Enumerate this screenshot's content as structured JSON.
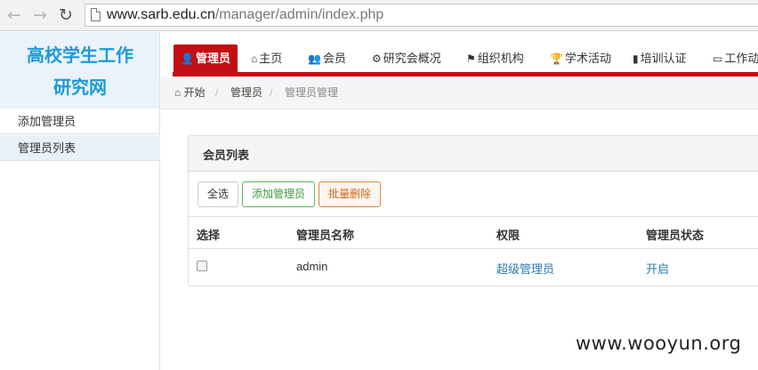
{
  "browser": {
    "back_icon": "←",
    "forward_icon": "→",
    "reload_icon": "↻",
    "url_host": "www.sarb.edu.cn",
    "url_path": "/manager/admin/index.php"
  },
  "logo": {
    "line1": "高校学生工作",
    "line2": "研究网",
    "color": "#1e9ad6"
  },
  "nav": {
    "accent": "#c50d14",
    "tabs": [
      {
        "icon": "user-icon",
        "glyph": "👤",
        "label": "管理员",
        "active": true
      },
      {
        "icon": "home-icon",
        "glyph": "⌂",
        "label": "主页"
      },
      {
        "icon": "users-icon",
        "glyph": "👥",
        "label": "会员"
      },
      {
        "icon": "gear-icon",
        "glyph": "⚙",
        "label": "研究会概况"
      },
      {
        "icon": "flag-icon",
        "glyph": "⚑",
        "label": "组织机构"
      },
      {
        "icon": "trophy-icon",
        "glyph": "🏆",
        "label": "学术活动"
      },
      {
        "icon": "bookmark-icon",
        "glyph": "▮",
        "label": "培训认证"
      },
      {
        "icon": "calendar-icon",
        "glyph": "▭",
        "label": "工作动态"
      }
    ]
  },
  "breadcrumb": {
    "home_icon": "⌂",
    "items": [
      "开始",
      "管理员",
      "管理员管理"
    ],
    "separator": "/"
  },
  "sidebar": {
    "items": [
      {
        "label": "添加管理员"
      },
      {
        "label": "管理员列表"
      }
    ]
  },
  "panel": {
    "title": "会员列表",
    "buttons": {
      "select_all": "全选",
      "add_admin": "添加管理员",
      "batch_delete": "批量删除"
    },
    "columns": [
      "选择",
      "管理员名称",
      "权限",
      "管理员状态"
    ],
    "rows": [
      {
        "name": "admin",
        "permission": "超级管理员",
        "status": "开启",
        "checked": false
      }
    ]
  },
  "watermark": "www.wooyun.org"
}
